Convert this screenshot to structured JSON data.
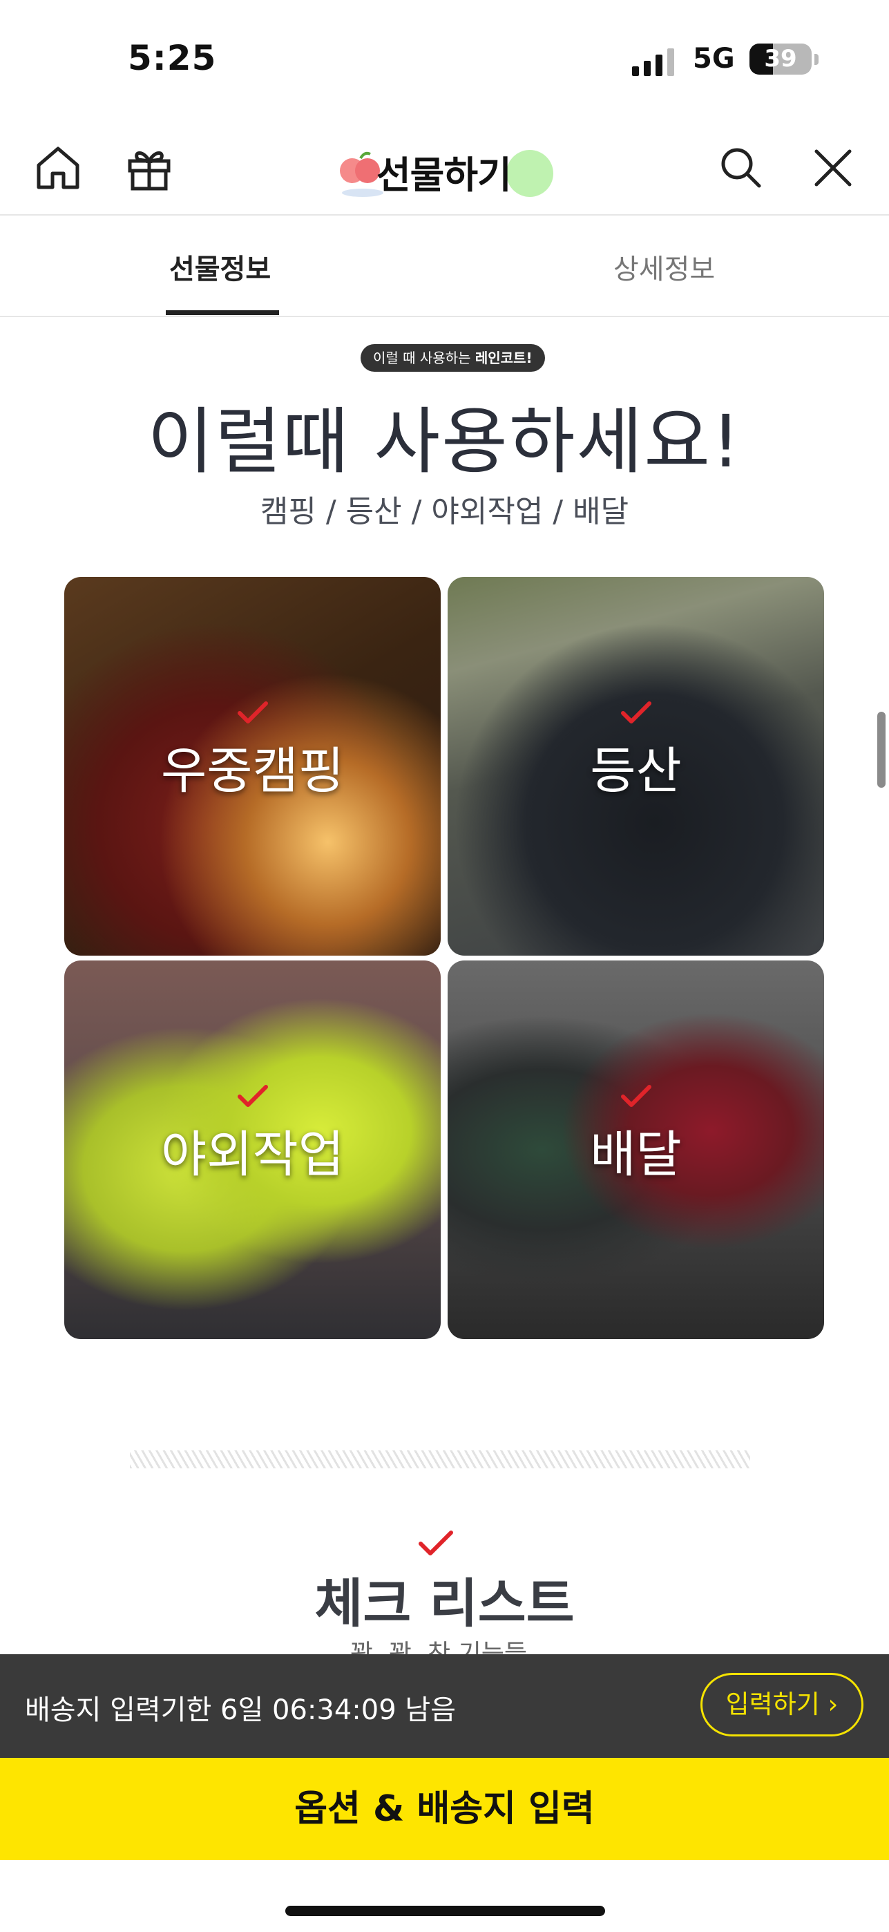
{
  "status_bar": {
    "time": "5:25",
    "network": "5G",
    "battery": "39"
  },
  "header": {
    "title": "선물하기"
  },
  "tabs": [
    {
      "label": "선물정보"
    },
    {
      "label": "상세정보"
    }
  ],
  "content": {
    "pill_prefix": "이럴 때 사용하는 ",
    "pill_bold": "레인코트!",
    "heading": "이럴때 사용하세요!",
    "subheading": "캠핑 / 등산 / 야외작업 / 배달",
    "tiles": [
      {
        "label": "우중캠핑"
      },
      {
        "label": "등산"
      },
      {
        "label": "야외작업"
      },
      {
        "label": "배달"
      }
    ],
    "checklist_title": "체크 리스트",
    "checklist_sub": "꽉. 꽉. 찬 기능들"
  },
  "deadline": {
    "text": "배송지 입력기한 6일 06:34:09 남음",
    "button": "입력하기 ›"
  },
  "cta": {
    "label": "옵션 & 배송지 입력"
  },
  "colors": {
    "accent_yellow": "#fee500",
    "dark_bar": "#3a3a3a",
    "check_red": "#e0242a"
  }
}
